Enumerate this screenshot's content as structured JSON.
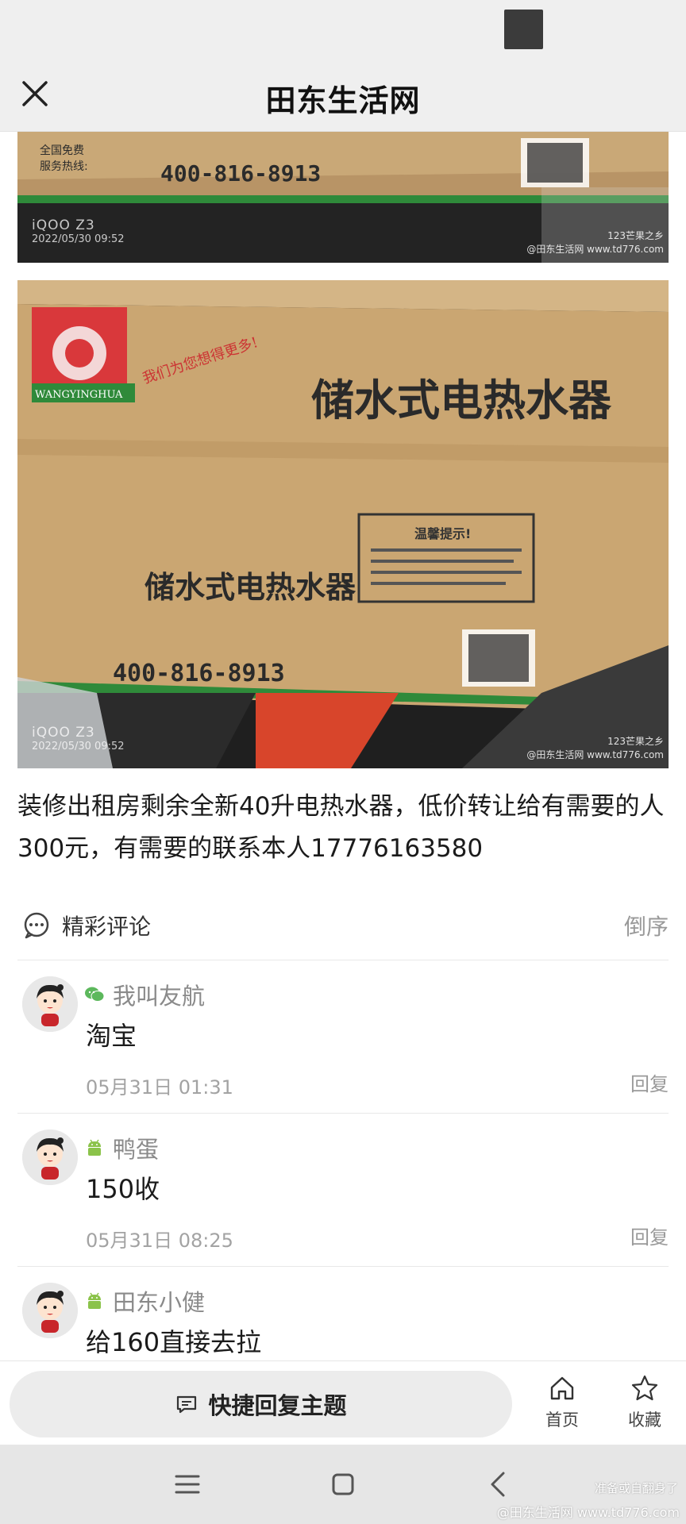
{
  "header": {
    "title": "田东生活网"
  },
  "photos": [
    {
      "box_line1": "全国免费",
      "box_line2": "服务热线:",
      "phone": "400-816-8913",
      "watermark_model": "iQOO Z3",
      "watermark_date": "2022/05/30 09:52",
      "watermark_right1": "123芒果之乡",
      "watermark_right2": "@田东生活网 www.td776.com"
    },
    {
      "brand": "WANGYINGHUA",
      "slogan": "我们为您想得更多!",
      "product": "储水式电热水器",
      "warning_title": "温馨提示!",
      "phone": "400-816-8913",
      "watermark_model": "iQOO Z3",
      "watermark_date": "2022/05/30 09:52",
      "watermark_right1": "123芒果之乡",
      "watermark_right2": "@田东生活网 www.td776.com"
    }
  ],
  "post": {
    "text": "装修出租房剩余全新40升电热水器，低价转让给有需要的人300元，有需要的联系本人17776163580"
  },
  "comments": {
    "title": "精彩评论",
    "sort_label": "倒序",
    "items": [
      {
        "user": "我叫友航",
        "platform_icon": "wechat-icon",
        "body": "淘宝",
        "time": "05月31日 01:31",
        "reply": "回复"
      },
      {
        "user": "鸭蛋",
        "platform_icon": "android-icon",
        "body": "150收",
        "time": "05月31日 08:25",
        "reply": "回复"
      },
      {
        "user": "田东小健",
        "platform_icon": "android-icon",
        "body": "给160直接去拉",
        "time": "",
        "reply": ""
      }
    ]
  },
  "bottom_bar": {
    "quick_reply_label": "快捷回复主题",
    "home_label": "首页",
    "favorite_label": "收藏"
  },
  "system": {
    "watermark1": "准备或自翻身了",
    "watermark2": "@田东生活网 www.td776.com"
  },
  "colors": {
    "wechat": "#5cb85c",
    "android": "#8bc34a",
    "header_bg": "#efefef"
  }
}
